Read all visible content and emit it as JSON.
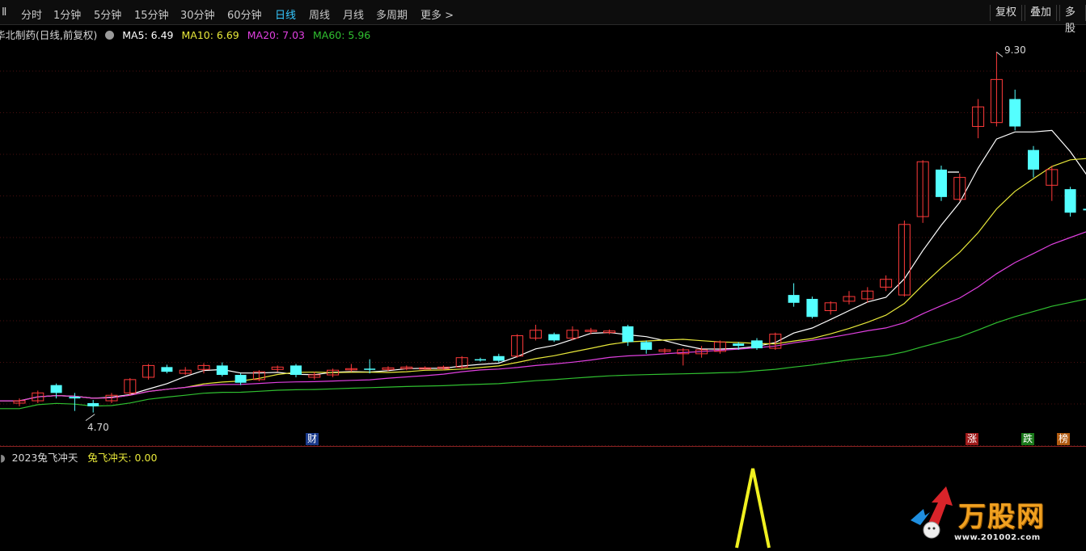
{
  "toolbar": {
    "left_glyph": "Ⅱ",
    "periods": [
      "分时",
      "1分钟",
      "5分钟",
      "15分钟",
      "30分钟",
      "60分钟",
      "日线",
      "周线",
      "月线",
      "多周期",
      "更多"
    ],
    "active_period": "日线",
    "more_chevron": ">",
    "right_buttons": [
      "复权",
      "叠加",
      "多股"
    ]
  },
  "info": {
    "stock_title": "华北制药(日线,前复权)",
    "ma5": "MA5: 6.49",
    "ma10": "MA10: 6.69",
    "ma20": "MA20: 7.03",
    "ma60": "MA60: 5.96",
    "colors": {
      "ma5": "#ffffff",
      "ma10": "#e8e83a",
      "ma20": "#e040e0",
      "ma60": "#30c030"
    }
  },
  "chart_labels": {
    "high": "9.30",
    "low": "4.70"
  },
  "badges": {
    "cai": "财",
    "zhang": "涨",
    "die": "跌",
    "bang": "榜"
  },
  "indicator": {
    "name": "2023兔飞冲天",
    "value": "兔飞冲天: 0.00"
  },
  "watermark": {
    "text": "万股网",
    "url": "www.201002.com"
  },
  "chart_data": {
    "type": "candlestick",
    "y_range": [
      4.5,
      9.5
    ],
    "candles": [
      [
        4.82,
        4.85,
        4.78,
        4.88,
        "up"
      ],
      [
        4.85,
        4.95,
        4.82,
        4.98,
        "up"
      ],
      [
        5.05,
        4.95,
        4.88,
        5.07,
        "down"
      ],
      [
        4.9,
        4.88,
        4.72,
        4.95,
        "down"
      ],
      [
        4.82,
        4.78,
        4.7,
        4.86,
        "down"
      ],
      [
        4.85,
        4.92,
        4.82,
        4.95,
        "up"
      ],
      [
        4.95,
        5.12,
        4.92,
        5.14,
        "up"
      ],
      [
        5.15,
        5.3,
        5.12,
        5.32,
        "up"
      ],
      [
        5.28,
        5.22,
        5.2,
        5.31,
        "down"
      ],
      [
        5.2,
        5.24,
        5.18,
        5.28,
        "up"
      ],
      [
        5.25,
        5.3,
        5.2,
        5.33,
        "up"
      ],
      [
        5.3,
        5.18,
        5.16,
        5.34,
        "down"
      ],
      [
        5.18,
        5.08,
        5.05,
        5.2,
        "down"
      ],
      [
        5.12,
        5.22,
        5.1,
        5.24,
        "up"
      ],
      [
        5.25,
        5.28,
        5.22,
        5.3,
        "up"
      ],
      [
        5.3,
        5.18,
        5.15,
        5.32,
        "down"
      ],
      [
        5.18,
        5.15,
        5.12,
        5.22,
        "up"
      ],
      [
        5.18,
        5.24,
        5.15,
        5.26,
        "up"
      ],
      [
        5.25,
        5.26,
        5.22,
        5.32,
        "up"
      ],
      [
        5.26,
        5.25,
        5.2,
        5.38,
        "down"
      ],
      [
        5.25,
        5.27,
        5.23,
        5.29,
        "up"
      ],
      [
        5.26,
        5.28,
        5.24,
        5.3,
        "up"
      ],
      [
        5.27,
        5.26,
        5.25,
        5.29,
        "up"
      ],
      [
        5.28,
        5.26,
        5.24,
        5.3,
        "up"
      ],
      [
        5.28,
        5.4,
        5.26,
        5.42,
        "up"
      ],
      [
        5.38,
        5.37,
        5.35,
        5.4,
        "down"
      ],
      [
        5.42,
        5.36,
        5.34,
        5.45,
        "down"
      ],
      [
        5.42,
        5.68,
        5.4,
        5.7,
        "up"
      ],
      [
        5.65,
        5.75,
        5.62,
        5.82,
        "up"
      ],
      [
        5.7,
        5.62,
        5.6,
        5.72,
        "down"
      ],
      [
        5.65,
        5.75,
        5.62,
        5.8,
        "up"
      ],
      [
        5.75,
        5.75,
        5.7,
        5.78,
        "up"
      ],
      [
        5.72,
        5.74,
        5.7,
        5.76,
        "up"
      ],
      [
        5.8,
        5.6,
        5.55,
        5.82,
        "down"
      ],
      [
        5.6,
        5.5,
        5.45,
        5.62,
        "down"
      ],
      [
        5.48,
        5.5,
        5.45,
        5.52,
        "up"
      ],
      [
        5.5,
        5.45,
        5.3,
        5.52,
        "up"
      ],
      [
        5.45,
        5.5,
        5.4,
        5.55,
        "up"
      ],
      [
        5.48,
        5.6,
        5.45,
        5.62,
        "up"
      ],
      [
        5.58,
        5.55,
        5.5,
        5.6,
        "down"
      ],
      [
        5.52,
        5.62,
        5.5,
        5.65,
        "down"
      ],
      [
        5.52,
        5.7,
        5.5,
        5.72,
        "up"
      ],
      [
        6.2,
        6.1,
        6.05,
        6.35,
        "down"
      ],
      [
        6.15,
        5.92,
        5.9,
        6.18,
        "down"
      ],
      [
        6.0,
        6.1,
        5.95,
        6.12,
        "up"
      ],
      [
        6.12,
        6.18,
        6.08,
        6.25,
        "up"
      ],
      [
        6.15,
        6.25,
        6.1,
        6.3,
        "up"
      ],
      [
        6.3,
        6.4,
        6.25,
        6.45,
        "up"
      ],
      [
        6.2,
        7.1,
        6.18,
        7.15,
        "up"
      ],
      [
        7.2,
        7.9,
        7.12,
        7.92,
        "up"
      ],
      [
        7.45,
        7.8,
        7.4,
        7.85,
        "down"
      ],
      [
        7.42,
        7.7,
        7.4,
        7.75,
        "up"
      ],
      [
        8.35,
        8.6,
        8.2,
        8.7,
        "up"
      ],
      [
        8.4,
        8.95,
        8.35,
        9.3,
        "up"
      ],
      [
        8.7,
        8.35,
        8.3,
        8.82,
        "down"
      ],
      [
        8.05,
        7.8,
        7.7,
        8.1,
        "down"
      ],
      [
        7.6,
        7.8,
        7.4,
        7.85,
        "up"
      ],
      [
        7.55,
        7.25,
        7.2,
        7.58,
        "down"
      ],
      [
        7.3,
        7.28,
        7.22,
        7.4,
        "down"
      ]
    ],
    "ma_series": [
      {
        "name": "MA5"
      },
      {
        "name": "MA10"
      },
      {
        "name": "MA20"
      },
      {
        "name": "MA60"
      }
    ],
    "indicator_series": {
      "name": "兔飞冲天",
      "value": 0.0
    }
  }
}
